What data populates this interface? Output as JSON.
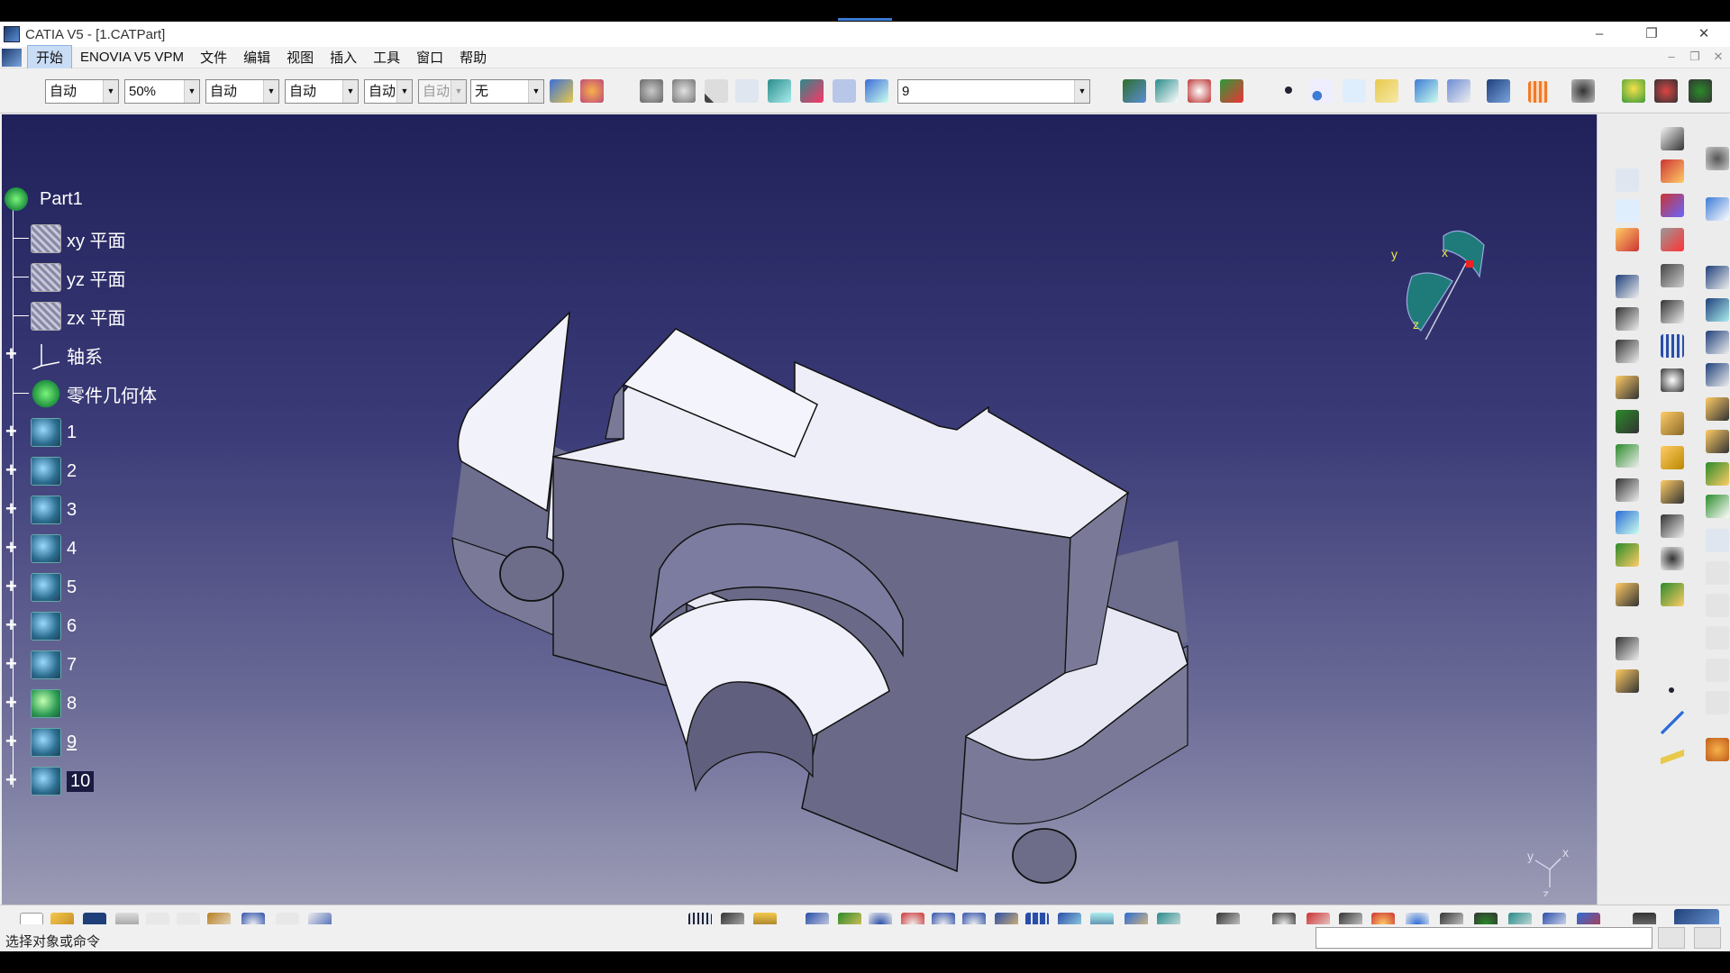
{
  "window": {
    "title": "CATIA V5 - [1.CATPart]",
    "controls": [
      "–",
      "❐",
      "✕"
    ]
  },
  "menubar": {
    "items": [
      "开始",
      "ENOVIA V5 VPM",
      "文件",
      "编辑",
      "视图",
      "插入",
      "工具",
      "窗口",
      "帮助"
    ],
    "mdi_controls": [
      "–",
      "❐",
      "✕"
    ]
  },
  "toolbar_top": {
    "combos": [
      {
        "value": "自动",
        "disabled": false
      },
      {
        "value": "50%",
        "disabled": false
      },
      {
        "value": "自动",
        "disabled": false
      },
      {
        "value": "自动",
        "disabled": false
      },
      {
        "value": "自动",
        "disabled": false
      },
      {
        "value": "自动",
        "disabled": true
      },
      {
        "value": "无",
        "disabled": false
      }
    ],
    "layer_combo": "9"
  },
  "tree": {
    "root": "Part1",
    "nodes": [
      {
        "label": "xy 平面",
        "kind": "plane",
        "expandable": false
      },
      {
        "label": "yz 平面",
        "kind": "plane",
        "expandable": false
      },
      {
        "label": "zx 平面",
        "kind": "plane",
        "expandable": false
      },
      {
        "label": "轴系",
        "kind": "axis",
        "expandable": true
      },
      {
        "label": "零件几何体",
        "kind": "geometry",
        "expandable": false
      },
      {
        "label": "1",
        "kind": "body",
        "expandable": true
      },
      {
        "label": "2",
        "kind": "body",
        "expandable": true
      },
      {
        "label": "3",
        "kind": "body",
        "expandable": true
      },
      {
        "label": "4",
        "kind": "body",
        "expandable": true
      },
      {
        "label": "5",
        "kind": "body",
        "expandable": true
      },
      {
        "label": "6",
        "kind": "body",
        "expandable": true
      },
      {
        "label": "7",
        "kind": "body",
        "expandable": true
      },
      {
        "label": "8",
        "kind": "body-active",
        "expandable": true
      },
      {
        "label": "9",
        "kind": "body",
        "expandable": true
      },
      {
        "label": "10",
        "kind": "body",
        "expandable": true
      }
    ]
  },
  "compass": {
    "x": "x",
    "y": "y",
    "z": "z"
  },
  "axis_indicator": {
    "x": "x",
    "y": "y",
    "z": "z"
  },
  "statusbar": {
    "prompt": "选择对象或命令"
  },
  "colors": {
    "viewport_top": "#20205a",
    "viewport_bottom": "#9c9cb6",
    "part_face": "#eeeef8",
    "part_side": "#6e6e8a"
  }
}
